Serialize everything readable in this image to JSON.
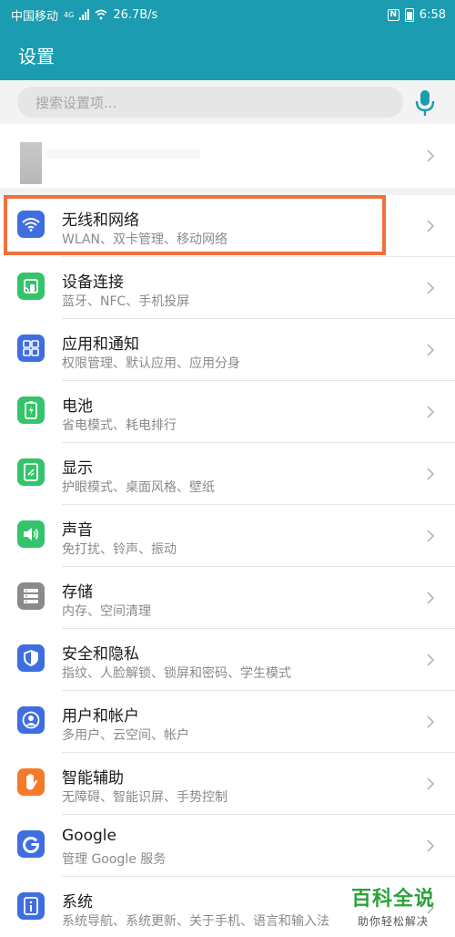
{
  "status_bar": {
    "carrier": "中国移动",
    "network_label": "4G",
    "speed": "26.7B/s",
    "nfc": "N",
    "time": "6:58"
  },
  "app_bar": {
    "title": "设置"
  },
  "search": {
    "placeholder": "搜索设置项..."
  },
  "colors": {
    "accent": "#1b9cb0",
    "highlight": "#f0703c",
    "wifi_icon": "#3f6ee0",
    "green_icon": "#34c46b",
    "gray_icon": "#8a8a8a",
    "google_icon": "#3f6ee0",
    "orange_icon": "#f47a2a"
  },
  "settings": [
    {
      "title": "无线和网络",
      "subtitle": "WLAN、双卡管理、移动网络",
      "icon": "wifi-icon",
      "color": "#3f6ee0"
    },
    {
      "title": "设备连接",
      "subtitle": "蓝牙、NFC、手机投屏",
      "icon": "device-connect-icon",
      "color": "#34c46b"
    },
    {
      "title": "应用和通知",
      "subtitle": "权限管理、默认应用、应用分身",
      "icon": "apps-icon",
      "color": "#3f6ee0"
    },
    {
      "title": "电池",
      "subtitle": "省电模式、耗电排行",
      "icon": "battery-icon",
      "color": "#34c46b"
    },
    {
      "title": "显示",
      "subtitle": "护眼模式、桌面风格、壁纸",
      "icon": "display-icon",
      "color": "#34c46b"
    },
    {
      "title": "声音",
      "subtitle": "免打扰、铃声、振动",
      "icon": "speaker-icon",
      "color": "#34c46b"
    },
    {
      "title": "存储",
      "subtitle": "内存、空间清理",
      "icon": "storage-icon",
      "color": "#8a8a8a"
    },
    {
      "title": "安全和隐私",
      "subtitle": "指纹、人脸解锁、锁屏和密码、学生模式",
      "icon": "shield-icon",
      "color": "#3f6ee0"
    },
    {
      "title": "用户和帐户",
      "subtitle": "多用户、云空间、帐户",
      "icon": "user-icon",
      "color": "#3f6ee0"
    },
    {
      "title": "智能辅助",
      "subtitle": "无障碍、智能识屏、手势控制",
      "icon": "hand-icon",
      "color": "#f47a2a"
    },
    {
      "title": "Google",
      "subtitle": "管理 Google 服务",
      "icon": "google-icon",
      "color": "#3f6ee0"
    },
    {
      "title": "系统",
      "subtitle": "系统导航、系统更新、关于手机、语言和输入法",
      "icon": "system-info-icon",
      "color": "#3f6ee0"
    }
  ],
  "watermark": {
    "title": "百科全说",
    "subtitle": "助你轻松解决"
  }
}
